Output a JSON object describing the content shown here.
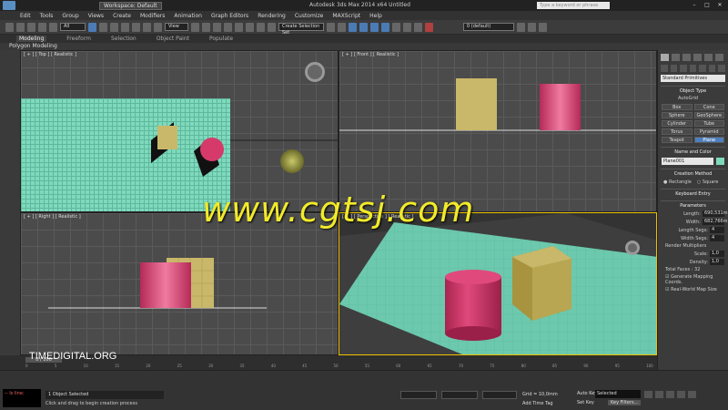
{
  "titlebar": {
    "workspace": "Workspace: Default",
    "title": "Autodesk 3ds Max 2014 x64     Untitled",
    "search_placeholder": "Type a keyword or phrase"
  },
  "menu": [
    "Edit",
    "Tools",
    "Group",
    "Views",
    "Create",
    "Modifiers",
    "Animation",
    "Graph Editors",
    "Rendering",
    "Customize",
    "MAXScript",
    "Help"
  ],
  "toolbar": {
    "filter": "All",
    "refcoord": "View",
    "selset": "Create Selection Set",
    "layer": "0 (default)"
  },
  "ribbon": {
    "tabs": [
      "Modeling",
      "Freeform",
      "Selection",
      "Object Paint",
      "Populate"
    ],
    "sub": "Polygon Modeling"
  },
  "viewports": {
    "top": "[ + ] [ Top ] [ Realistic ]",
    "front": "[ + ] [ Front ] [ Realistic ]",
    "left": "[ + ] [ Right ] [ Realistic ]",
    "persp": "[ + ] [ Perspective ] [ Realistic ]"
  },
  "timeline": {
    "slider": "0 / 100",
    "ticks": [
      "0",
      "5",
      "10",
      "15",
      "20",
      "25",
      "30",
      "35",
      "40",
      "45",
      "50",
      "55",
      "60",
      "65",
      "70",
      "75",
      "80",
      "85",
      "90",
      "95",
      "100"
    ]
  },
  "status": {
    "listener": "-- Is line:",
    "objects": "1 Object Selected",
    "prompt": "Click and drag to begin creation process",
    "grid": "Grid = 10,0mm",
    "addtime": "Add Time Tag",
    "autokey": "Auto Key",
    "selected": "Selected",
    "setkey": "Set Key",
    "keyfilters": "Key Filters..."
  },
  "cmd": {
    "category": "Standard Primitives",
    "objtype_title": "Object Type",
    "autogrid": "AutoGrid",
    "buttons": [
      "Box",
      "Cone",
      "Sphere",
      "GeoSphere",
      "Cylinder",
      "Tube",
      "Torus",
      "Pyramid",
      "Teapot",
      "Plane"
    ],
    "name_title": "Name and Color",
    "name": "Plane001",
    "method_title": "Creation Method",
    "method_opts": [
      "Rectangle",
      "Square"
    ],
    "keyboard": "Keyboard Entry",
    "params_title": "Parameters",
    "length_label": "Length:",
    "length": "690,531m",
    "width_label": "Width:",
    "width": "682,766m",
    "lsegs_label": "Length Segs:",
    "lsegs": "4",
    "wsegs_label": "Width Segs:",
    "wsegs": "4",
    "rmult": "Render Multipliers",
    "scale_label": "Scale:",
    "scale": "1,0",
    "density_label": "Density:",
    "density": "1,0",
    "faces": "Total Faces : 32",
    "genmap": "Generate Mapping Coords.",
    "realworld": "Real-World Map Size"
  },
  "overlay": {
    "watermark": "www.cgtsj.com",
    "brand": "TIMEDIGITAL.ORG"
  },
  "colors": {
    "plane": "#7fd9bd",
    "cylinder": "#d63a6a",
    "box": "#c9b86a",
    "highlight": "#f0c000"
  }
}
